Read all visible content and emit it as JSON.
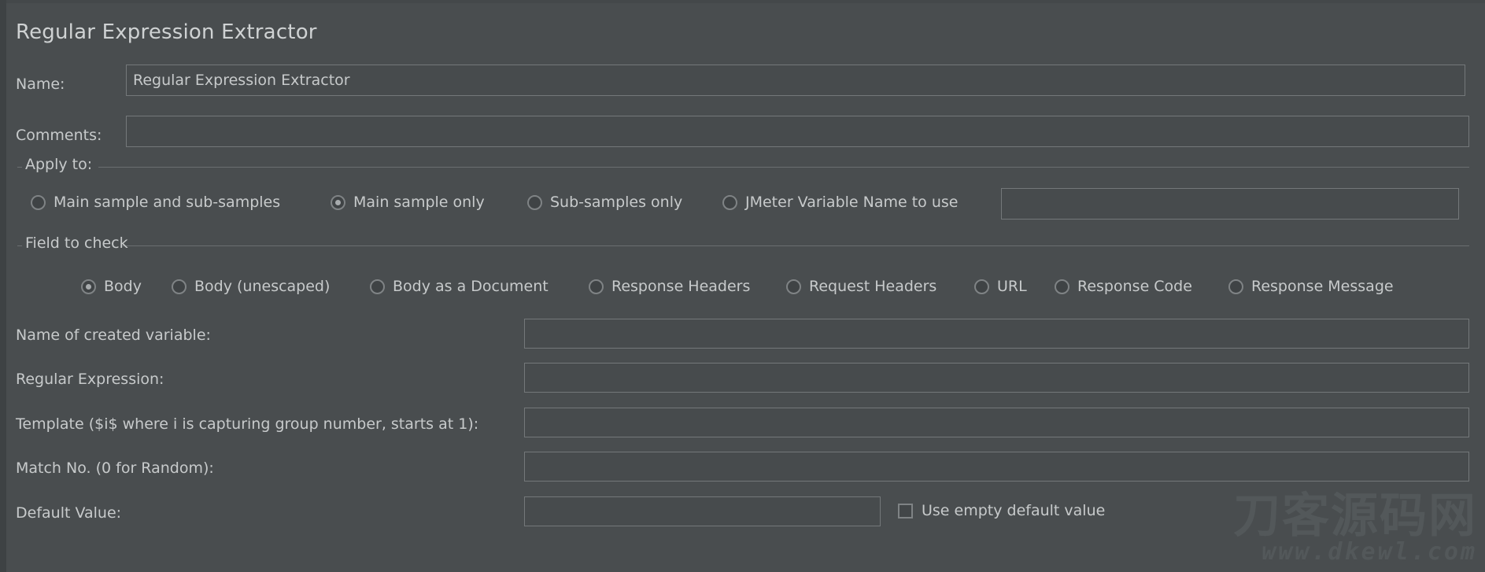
{
  "panel": {
    "title": "Regular Expression Extractor"
  },
  "fields": {
    "name": {
      "label": "Name:",
      "value": "Regular Expression Extractor",
      "placeholder": ""
    },
    "comments": {
      "label": "Comments:",
      "value": "",
      "placeholder": ""
    },
    "created_variable": {
      "label": "Name of created variable:",
      "value": "",
      "placeholder": ""
    },
    "regular_expression": {
      "label": "Regular Expression:",
      "value": "",
      "placeholder": ""
    },
    "template": {
      "label": "Template ($i$ where i is capturing group number, starts at 1):",
      "value": "",
      "placeholder": ""
    },
    "match_no": {
      "label": "Match No. (0 for Random):",
      "value": "",
      "placeholder": ""
    },
    "default_value": {
      "label": "Default Value:",
      "value": "",
      "placeholder": ""
    },
    "jmeter_variable": {
      "value": "",
      "placeholder": ""
    }
  },
  "apply_to": {
    "title": "Apply to:",
    "options": [
      {
        "label": "Main sample and sub-samples",
        "selected": false
      },
      {
        "label": "Main sample only",
        "selected": true
      },
      {
        "label": "Sub-samples only",
        "selected": false
      },
      {
        "label": "JMeter Variable Name to use",
        "selected": false
      }
    ]
  },
  "field_to_check": {
    "title": "Field to check",
    "options": [
      {
        "label": "Body",
        "selected": true
      },
      {
        "label": "Body (unescaped)",
        "selected": false
      },
      {
        "label": "Body as a Document",
        "selected": false
      },
      {
        "label": "Response Headers",
        "selected": false
      },
      {
        "label": "Request Headers",
        "selected": false
      },
      {
        "label": "URL",
        "selected": false
      },
      {
        "label": "Response Code",
        "selected": false
      },
      {
        "label": "Response Message",
        "selected": false
      }
    ]
  },
  "use_empty_default_value": {
    "label": "Use empty default value",
    "checked": false
  },
  "watermark": {
    "cn": "刀客源码网",
    "url": "www.dkewl.com"
  },
  "colors": {
    "background": "#494d4f",
    "input_background": "#474b4d",
    "input_border": "#74787a",
    "text": "#c7cacb",
    "title_text": "#cfd2d3",
    "group_border": "#6b6f71",
    "control_border": "#7f8385",
    "watermark": "#53585a"
  }
}
